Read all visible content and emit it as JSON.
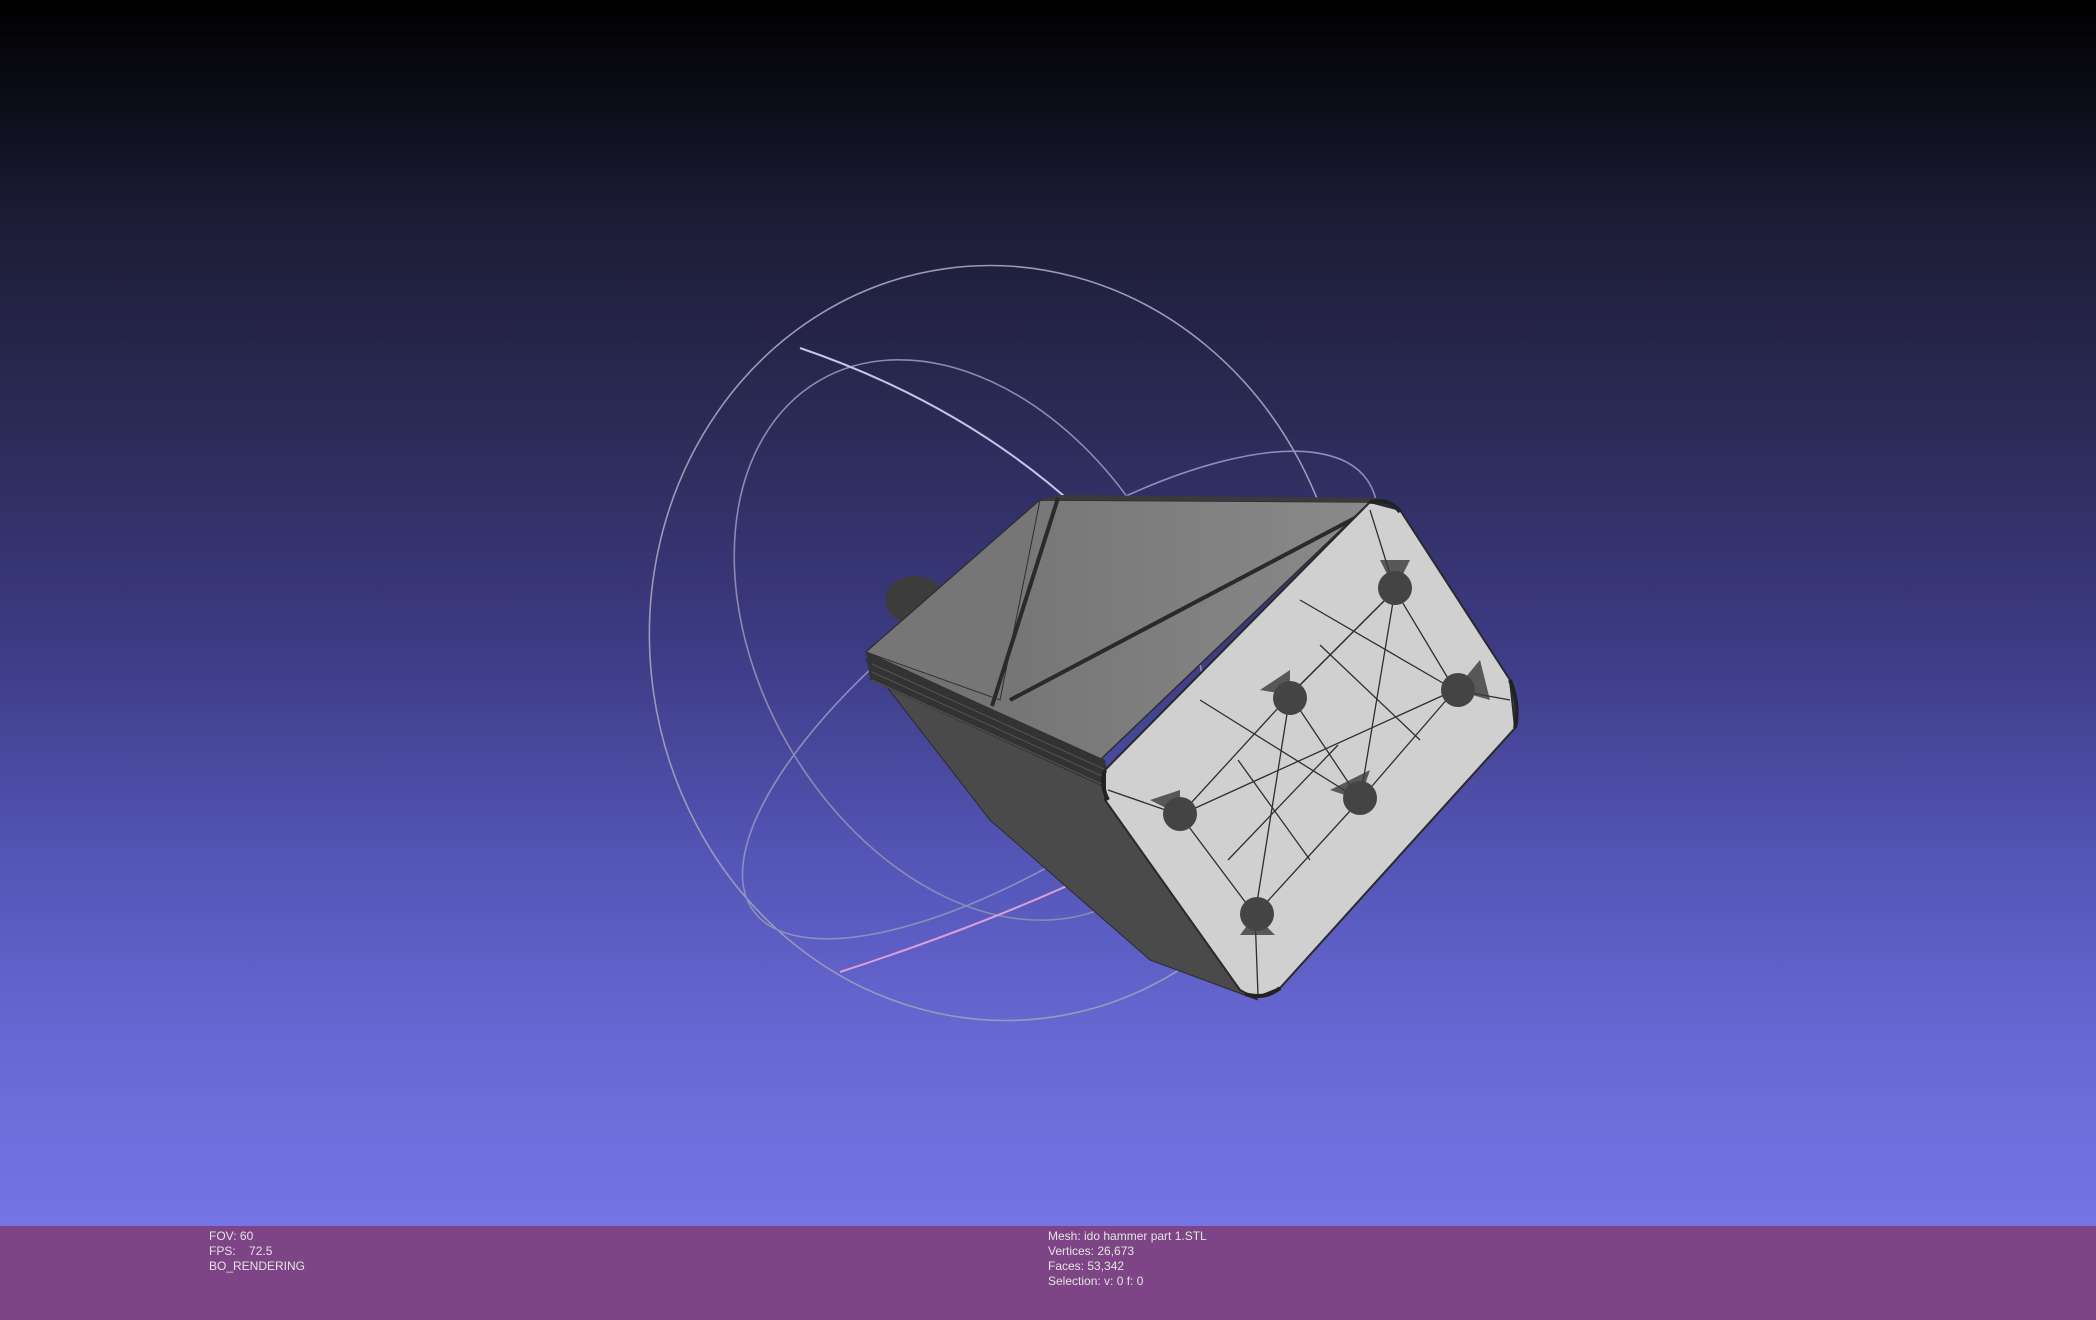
{
  "viewer": {
    "fov_label": "FOV: 60",
    "fps_label": "FPS:",
    "fps_value": "72.5",
    "render_mode": "BO_RENDERING",
    "mesh_label": "Mesh: ido hammer part 1.STL",
    "vertices_label": "Vertices: 26,673",
    "faces_label": "Faces: 53,342",
    "selection_label": "Selection: v: 0 f: 0"
  },
  "colors": {
    "background_top": "#000000",
    "background_bottom": "#7474e6",
    "statusbar": "#7d4585",
    "statusbar_text": "#e4e4e4",
    "mesh_dark": "#5c5c5c",
    "mesh_light": "#c8c8c8"
  },
  "icons": [
    "trackball-gizmo",
    "mesh-model"
  ]
}
